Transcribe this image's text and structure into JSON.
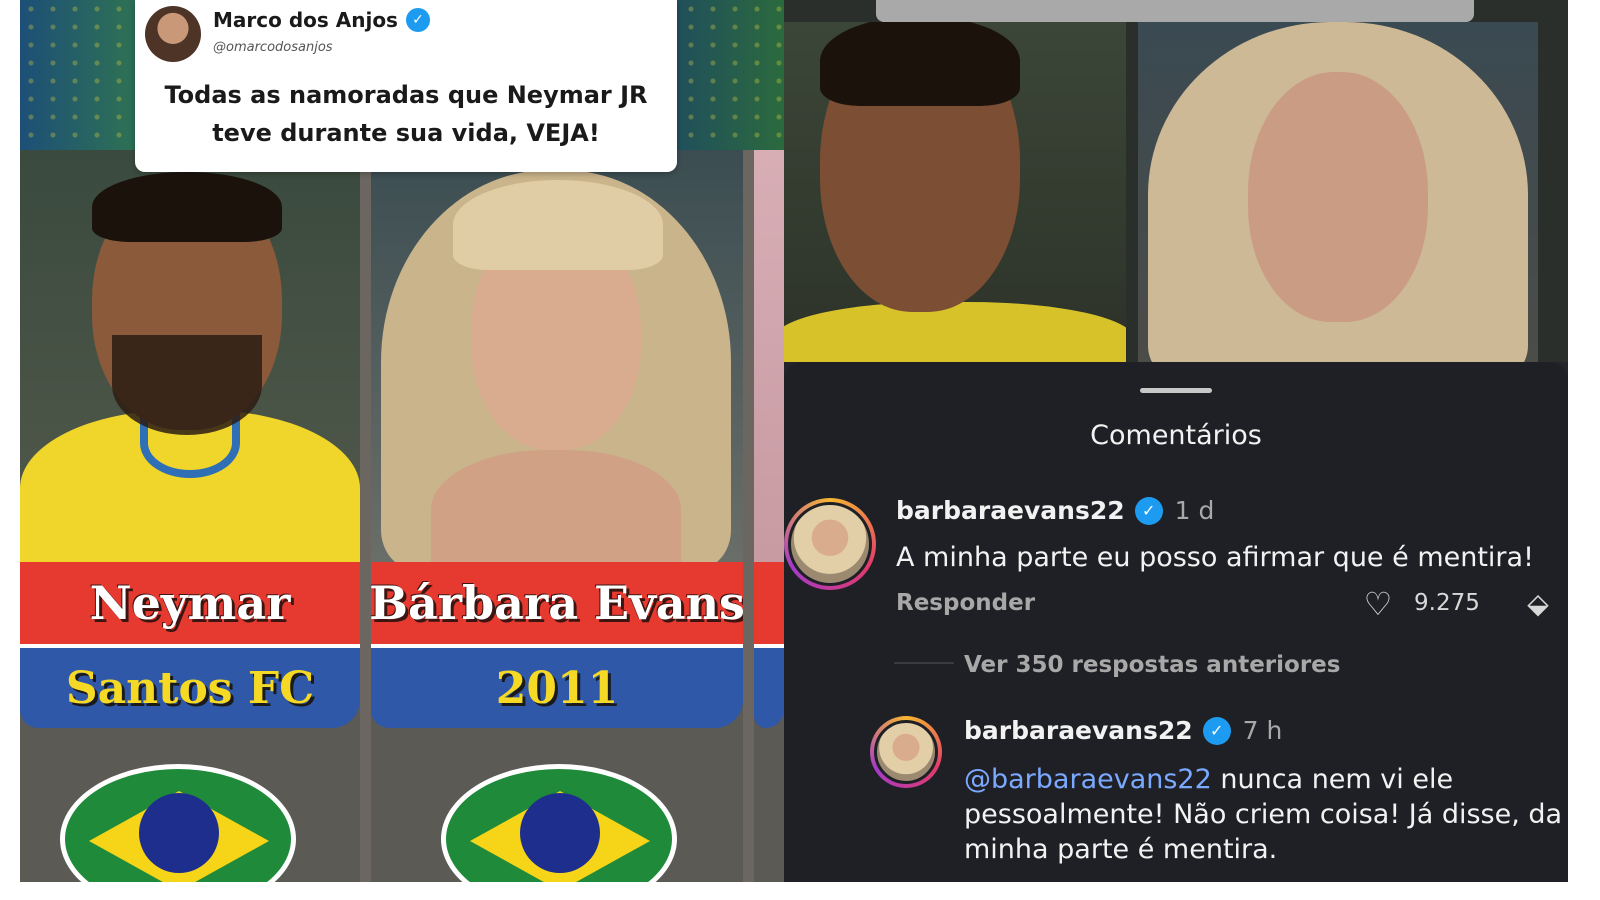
{
  "tweet": {
    "author_name": "Marco dos Anjos",
    "author_handle": "@omarcodosanjos",
    "text": "Todas as namoradas que Neymar JR teve durante sua vida, VEJA!"
  },
  "cards": [
    {
      "name": "Neymar",
      "subtitle": "Santos FC"
    },
    {
      "name": "Bárbara Evans",
      "subtitle": "2011"
    }
  ],
  "colors": {
    "name_bar": "#e6392f",
    "sub_bar": "#2f58a8",
    "sub_text": "#f5d924",
    "verified": "#1d9bf0",
    "mention": "#7aa9ff",
    "sheet_bg": "#1f2025"
  },
  "comments_sheet": {
    "title": "Comentários",
    "comment": {
      "username": "barbaraevans22",
      "time": "1 d",
      "text": "A minha parte eu posso afirmar que é mentira!",
      "reply_label": "Responder",
      "likes": "9.275"
    },
    "view_more_replies": "Ver 350 respostas anteriores",
    "reply": {
      "username": "barbaraevans22",
      "time": "7 h",
      "mention": "@barbaraevans22",
      "text": " nunca nem vi ele pessoalmente! Não criem coisa! Já disse, da minha parte é mentira."
    }
  },
  "icons": {
    "verified": "verified-badge-icon",
    "like": "heart-icon",
    "dislike": "thumbs-down-icon"
  }
}
